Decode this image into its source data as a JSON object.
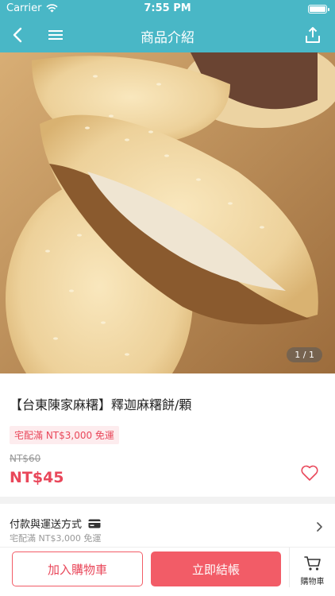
{
  "status_bar": {
    "carrier": "Carrier",
    "time": "7:55 PM"
  },
  "nav": {
    "title": "商品介紹",
    "back_icon": "chevron-left-icon",
    "menu_icon": "menu-icon",
    "share_icon": "share-icon"
  },
  "gallery": {
    "counter": "1 / 1"
  },
  "product": {
    "name": "【台東陳家麻糬】釋迦麻糬餅/顆",
    "shipping_tag": "宅配滿 NT$3,000 免運",
    "original_price": "NT$60",
    "price": "NT$45"
  },
  "payment": {
    "label": "付款與運送方式",
    "sub": "宅配滿 NT$3,000 免運"
  },
  "actions": {
    "add_to_cart": "加入購物車",
    "buy_now": "立即結帳",
    "cart": "購物車"
  },
  "colors": {
    "nav_bg": "#49b7c6",
    "accent": "#f25c67",
    "price": "#e9475a"
  }
}
